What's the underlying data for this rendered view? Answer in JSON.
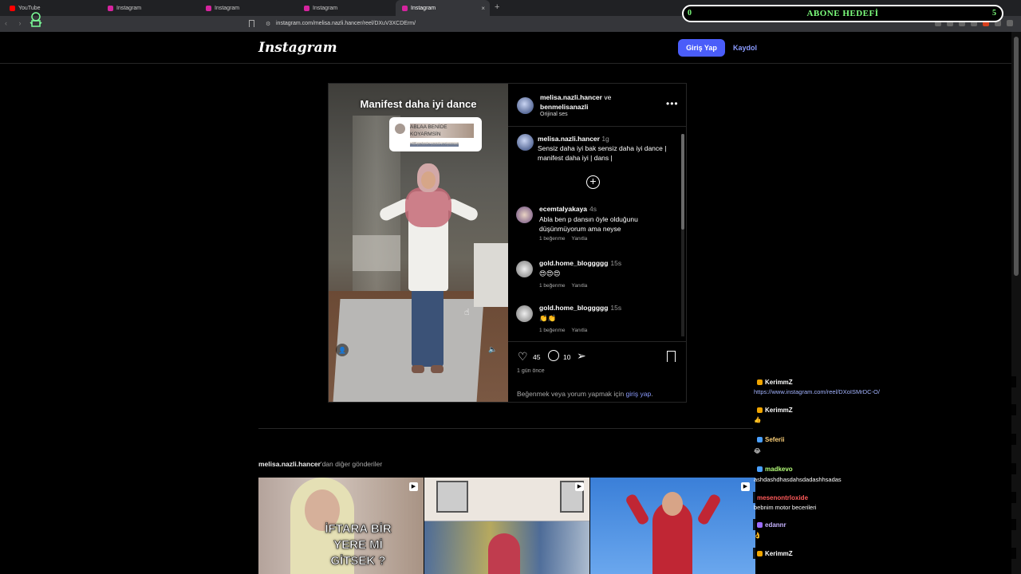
{
  "browser": {
    "tabs": [
      {
        "label": "YouTube",
        "active": false,
        "color": "#ff0000"
      },
      {
        "label": "Instagram",
        "active": false,
        "color": "#d6249f"
      },
      {
        "label": "Instagram",
        "active": false,
        "color": "#d6249f"
      },
      {
        "label": "Instagram",
        "active": false,
        "color": "#d6249f"
      },
      {
        "label": "Instagram",
        "active": true,
        "color": "#d6249f"
      }
    ],
    "new_tab": "+",
    "close_tab": "×",
    "url": "instagram.com/melisa.nazli.hancer/reel/DXuV3XCDErm/"
  },
  "goal_overlay": {
    "left": "0",
    "title": "ABONE HEDEFİ",
    "right": "5"
  },
  "header": {
    "logo": "Instagram",
    "login": "Giriş Yap",
    "signup": "Kaydol"
  },
  "reel": {
    "video_title": "Manifest daha iyi dance",
    "reply_text": "ABLAA BENİDE KOYARMSİN",
    "reply_sub": "eliff.pelvn'e yanıt veriyorsun",
    "owner_line1": "melisa.nazli.hancer",
    "owner_and": " ve",
    "owner_line2": "benmelisanazli",
    "owner_sub": "Orijinal ses",
    "caption_user": "melisa.nazli.hancer",
    "caption_time": "1g",
    "caption_text": "Sensiz daha iyi bak sensiz daha iyi dance | manifest daha iyi | dans |",
    "comments": [
      {
        "user": "ecemtalyakaya",
        "time": "4s",
        "text": "Abla ben p dansın öyle olduğunu düşünmüyorum ama neyse",
        "likes": "1 beğenme",
        "reply": "Yanıtla"
      },
      {
        "user": "gold.home_bloggggg",
        "time": "15s",
        "text": "😍😍😍",
        "likes": "1 beğenme",
        "reply": "Yanıtla"
      },
      {
        "user": "gold.home_bloggggg",
        "time": "15s",
        "text": "👏👏",
        "likes": "1 beğenme",
        "reply": "Yanıtla"
      }
    ],
    "likes": "45",
    "comment_count": "10",
    "date": "1 gün önce",
    "login_prompt": "Beğenmek veya yorum yapmak için ",
    "login_link": "giriş yap",
    "login_end": "."
  },
  "more_posts": {
    "user": "melisa.nazli.hancer",
    "suffix": "'dan diğer gönderiler",
    "thumb1_caption": "İFTARA BİR YERE Mİ GİTSEK ?"
  },
  "chat": [
    {
      "user": "KerimmZ",
      "color": "#ffffff",
      "msg": "https://www.instagram.com/reel/DXoISMrDC-O/",
      "is_link": true
    },
    {
      "user": "KerimmZ",
      "color": "#ffffff",
      "msg": "👍",
      "is_link": false
    },
    {
      "user": "Seferii",
      "color": "#ffd27a",
      "msg": "😂",
      "is_link": false
    },
    {
      "user": "madkevo",
      "color": "#b6ff7a",
      "msg": "ashdashdhasdahsdadashhsadas",
      "is_link": false
    },
    {
      "user": "mesenontrloxide",
      "color": "#ff5a5a",
      "msg": "bebnim motor becerileri",
      "is_link": false
    },
    {
      "user": "edannr",
      "color": "#c7b3ff",
      "msg": "👌",
      "is_link": false
    },
    {
      "user": "KerimmZ",
      "color": "#ffffff",
      "msg": "",
      "is_link": false
    }
  ]
}
